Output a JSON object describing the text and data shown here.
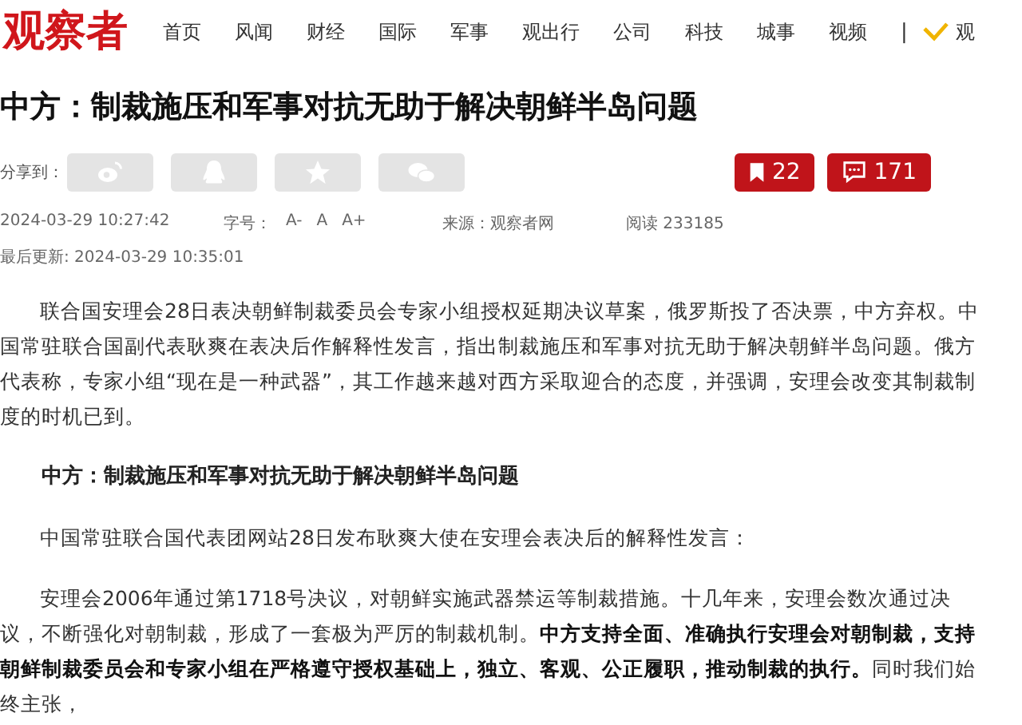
{
  "header": {
    "logo": "观察者",
    "nav": [
      {
        "label": "首页"
      },
      {
        "label": "风闻"
      },
      {
        "label": "财经"
      },
      {
        "label": "国际"
      },
      {
        "label": "军事"
      },
      {
        "label": "观出行"
      },
      {
        "label": "公司"
      },
      {
        "label": "科技"
      },
      {
        "label": "城事"
      },
      {
        "label": "视频"
      }
    ],
    "separator": "|",
    "cut_label": "观"
  },
  "article": {
    "title": "中方：制裁施压和军事对抗无助于解决朝鲜半岛问题",
    "share": {
      "label": "分享到：",
      "buttons": [
        {
          "kind": "weibo"
        },
        {
          "kind": "qq"
        },
        {
          "kind": "qzone"
        },
        {
          "kind": "wechat"
        }
      ]
    },
    "counters": [
      {
        "kind": "bookmark",
        "value": "22"
      },
      {
        "kind": "comment",
        "value": "171"
      }
    ],
    "meta": {
      "published": "2024-03-29 10:27:42",
      "font_label": "字号：",
      "font_sizes": [
        "A-",
        "A",
        "A+"
      ],
      "source": "来源：观察者网",
      "reads": "阅读 233185",
      "updated": "最后更新: 2024-03-29 10:35:01"
    },
    "body": [
      {
        "kind": "paragraph",
        "text": "联合国安理会28日表决朝鲜制裁委员会专家小组授权延期决议草案，俄罗斯投了否决票，中方弃权。中国常驻联合国副代表耿爽在表决后作解释性发言，指出制裁施压和军事对抗无助于解决朝鲜半岛问题。俄方代表称，专家小组“现在是一种武器”，其工作越来越对西方采取迎合的态度，并强调，安理会改变其制裁制度的时机已到。"
      },
      {
        "kind": "heading",
        "text": "中方：制裁施压和军事对抗无助于解决朝鲜半岛问题"
      },
      {
        "kind": "paragraph",
        "text": "中国常驻联合国代表团网站28日发布耿爽大使在安理会表决后的解释性发言："
      },
      {
        "kind": "paragraph",
        "text": "安理会2006年通过第1718号决议，对朝鲜实施武器禁运等制裁措施。十几年来，安理会数次通过决议，不断强化对朝制裁，形成了一套极为严厉的制裁机制。**中方支持全面、准确执行安理会对朝制裁，支持朝鲜制裁委员会和专家小组在严格遵守授权基础上，独立、客观、公正履职，推动制裁的执行。**同时我们始终主张，"
      }
    ]
  }
}
